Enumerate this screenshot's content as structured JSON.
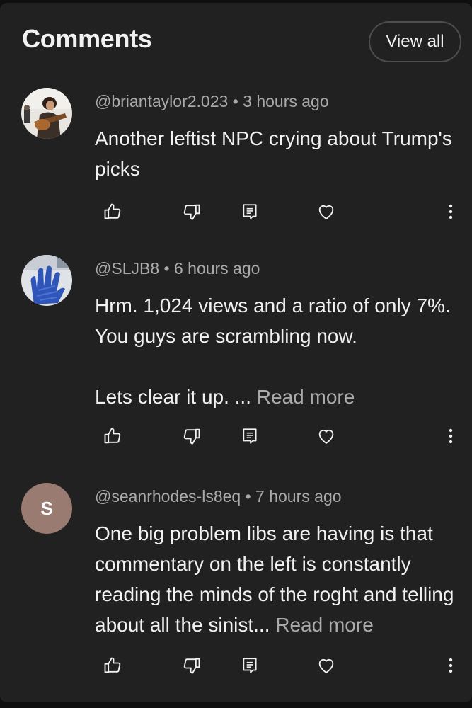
{
  "header": {
    "title": "Comments",
    "view_all_label": "View all"
  },
  "comments": [
    {
      "author": "@briantaylor2.023",
      "age": "3 hours ago",
      "text": "Another leftist NPC crying about Trump's picks",
      "read_more": "",
      "avatar": {
        "type": "photo",
        "description_icon": "guitarist-photo-avatar"
      }
    },
    {
      "author": "@SLJB8",
      "age": "6 hours ago",
      "text_paragraph_1": "Hrm. 1,024 views and a ratio of only 7%. You guys are scrambling now.",
      "text_paragraph_2": "Lets clear it up. ...",
      "read_more": "Read more",
      "avatar": {
        "type": "photo",
        "description_icon": "blue-glove-photo-avatar"
      }
    },
    {
      "author": "@seanrhodes-ls8eq",
      "age": "7 hours ago",
      "text": "One big problem libs are having is that commentary on the left is constantly reading the minds of the roght and telling about all the sinist...",
      "read_more": "Read more",
      "avatar": {
        "type": "letter",
        "letter": "S",
        "color": "#9a7b72"
      }
    }
  ],
  "separator": "•",
  "icons": [
    "like-icon",
    "dislike-icon",
    "reply-icon",
    "heart-icon",
    "more-options-icon"
  ],
  "colors": {
    "background": "#212121",
    "text": "#f1f1f1",
    "secondary_text": "#aaaaaa",
    "border": "#4d4d4d"
  }
}
